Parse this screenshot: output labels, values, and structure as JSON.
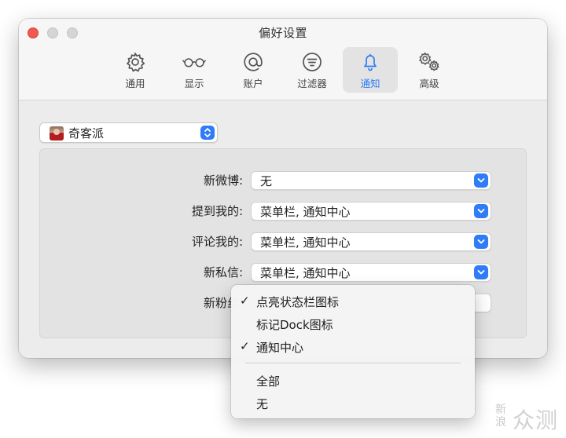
{
  "window": {
    "title": "偏好设置"
  },
  "toolbar": {
    "tabs": [
      {
        "label": "通用",
        "icon": "gear-icon"
      },
      {
        "label": "显示",
        "icon": "glasses-icon"
      },
      {
        "label": "账户",
        "icon": "at-sign-icon"
      },
      {
        "label": "过滤器",
        "icon": "filter-icon"
      },
      {
        "label": "通知",
        "icon": "bell-icon",
        "selected": true
      },
      {
        "label": "高级",
        "icon": "gears-icon"
      }
    ]
  },
  "account": {
    "name": "奇客派"
  },
  "notifications": {
    "rows": [
      {
        "label": "新微博:",
        "value": "无"
      },
      {
        "label": "提到我的:",
        "value": "菜单栏, 通知中心"
      },
      {
        "label": "评论我的:",
        "value": "菜单栏, 通知中心"
      },
      {
        "label": "新私信:",
        "value": "菜单栏, 通知中心"
      },
      {
        "label": "新粉丝:",
        "value": ""
      }
    ]
  },
  "dropdown_menu": {
    "items": [
      {
        "label": "点亮状态栏图标",
        "checked": true
      },
      {
        "label": "标记Dock图标",
        "checked": false
      },
      {
        "label": "通知中心",
        "checked": true
      }
    ],
    "items_after_separator": [
      {
        "label": "全部"
      },
      {
        "label": "无"
      }
    ],
    "check_glyph": "✓"
  },
  "watermark": {
    "small": "新浪",
    "big": "众测"
  },
  "colors": {
    "accent": "#2f7cf6",
    "close": "#ee5a52"
  }
}
